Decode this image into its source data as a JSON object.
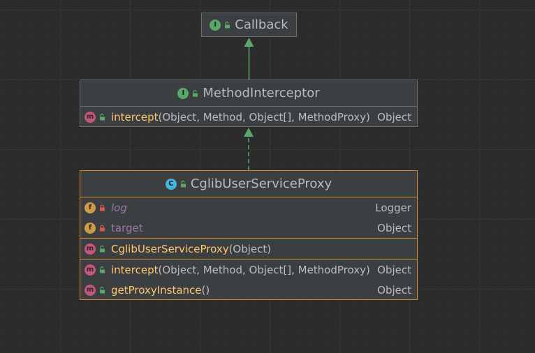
{
  "diagram": {
    "nodes": [
      {
        "id": "callback",
        "kind": "interface",
        "kind_letter": "I",
        "title": "Callback",
        "selected": false,
        "sections": []
      },
      {
        "id": "method-interceptor",
        "kind": "interface",
        "kind_letter": "I",
        "title": "MethodInterceptor",
        "selected": false,
        "sections": [
          {
            "rows": [
              {
                "kind": "method",
                "kind_letter": "m",
                "visibility": "public",
                "name": "intercept",
                "params": "(Object, Method, Object[], MethodProxy)",
                "type": "Object"
              }
            ]
          }
        ]
      },
      {
        "id": "cglib-user-service-proxy",
        "kind": "class",
        "kind_letter": "C",
        "title": "CglibUserServiceProxy",
        "selected": true,
        "sections": [
          {
            "rows": [
              {
                "kind": "field",
                "kind_letter": "f",
                "visibility": "private",
                "static": true,
                "name": "log",
                "params": "",
                "type": "Logger"
              },
              {
                "kind": "field",
                "kind_letter": "f",
                "visibility": "private",
                "static": false,
                "name": "target",
                "params": "",
                "type": "Object"
              }
            ]
          },
          {
            "rows": [
              {
                "kind": "method",
                "kind_letter": "m",
                "visibility": "public",
                "name": "CglibUserServiceProxy",
                "params": "(Object)",
                "type": ""
              }
            ]
          },
          {
            "rows": [
              {
                "kind": "method",
                "kind_letter": "m",
                "visibility": "public",
                "name": "intercept",
                "params": "(Object, Method, Object[], MethodProxy)",
                "type": "Object"
              },
              {
                "kind": "method",
                "kind_letter": "m",
                "visibility": "public",
                "name": "getProxyInstance",
                "params": "()",
                "type": "Object"
              }
            ]
          }
        ]
      }
    ],
    "edges": [
      {
        "from": "method-interceptor",
        "to": "callback",
        "relation": "extends",
        "style": "solid"
      },
      {
        "from": "cglib-user-service-proxy",
        "to": "method-interceptor",
        "relation": "implements",
        "style": "dashed"
      }
    ],
    "colors": {
      "background": "#2b2b2b",
      "node_fill": "#3c3f41",
      "node_border": "#6e6e6e",
      "selected_border": "#d88a2a",
      "edge": "#59a869",
      "method_name": "#ffc66d",
      "field_name": "#9876aa",
      "text": "#bbbbbb"
    }
  }
}
